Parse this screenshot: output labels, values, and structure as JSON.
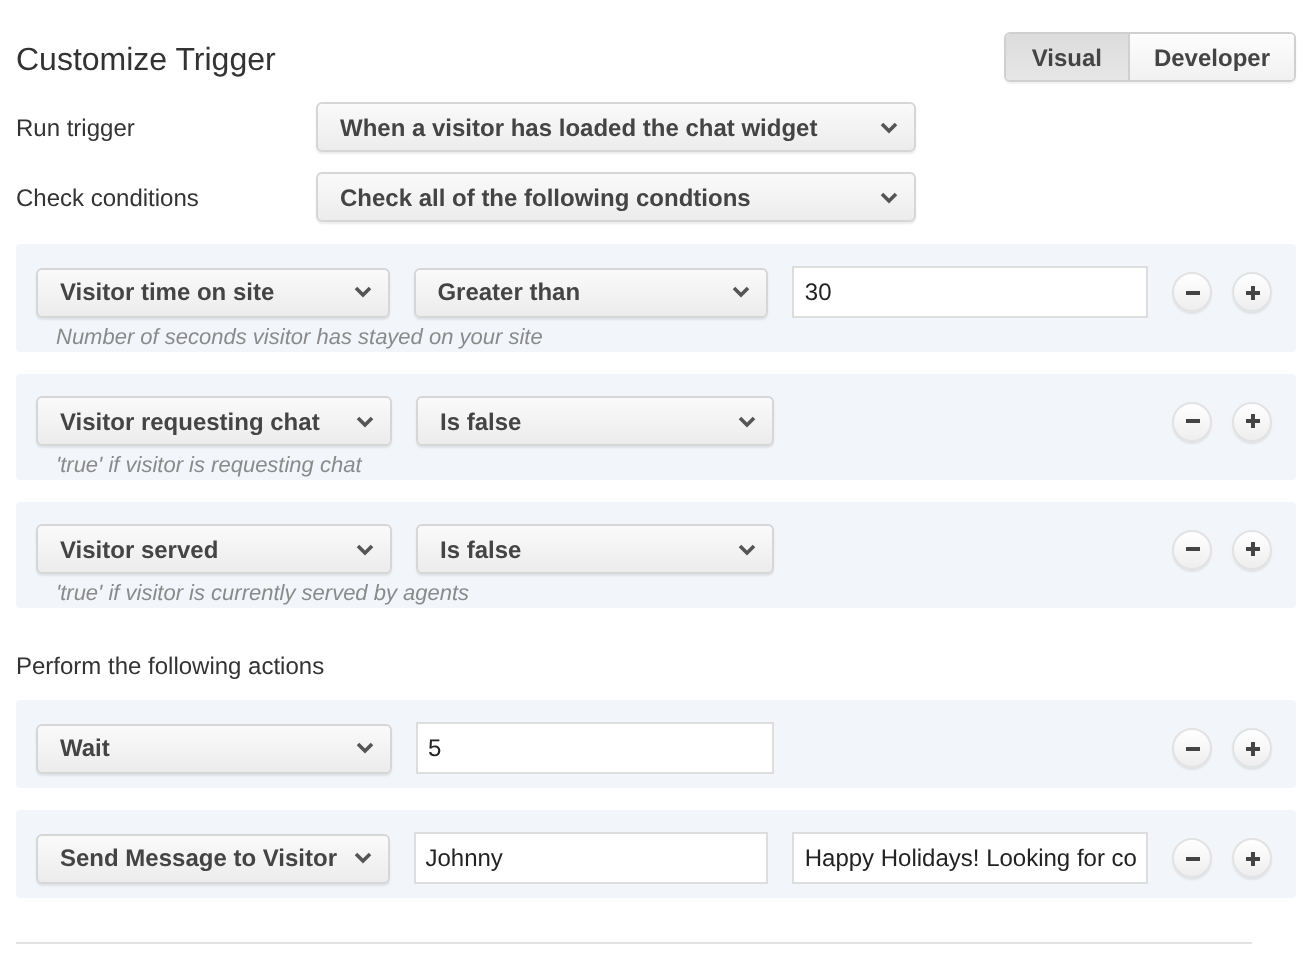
{
  "title": "Customize Trigger",
  "mode_tabs": [
    {
      "label": "Visual",
      "selected": true
    },
    {
      "label": "Developer",
      "selected": false
    }
  ],
  "settings": [
    {
      "label": "Run trigger",
      "value": "When a visitor has loaded the chat widget"
    },
    {
      "label": "Check conditions",
      "value": "Check all of the following condtions"
    }
  ],
  "conditions": [
    {
      "fields": [
        {
          "kind": "select",
          "value": "Visitor time on site"
        },
        {
          "kind": "select",
          "value": "Greater than"
        },
        {
          "kind": "input",
          "value": "30"
        }
      ],
      "hint": "Number of seconds visitor has stayed on your site"
    },
    {
      "fields": [
        {
          "kind": "select",
          "value": "Visitor requesting chat"
        },
        {
          "kind": "select",
          "value": "Is false"
        }
      ],
      "hint": "'true' if visitor is requesting chat"
    },
    {
      "fields": [
        {
          "kind": "select",
          "value": "Visitor served"
        },
        {
          "kind": "select",
          "value": "Is false"
        }
      ],
      "hint": "'true' if visitor is currently served by agents"
    }
  ],
  "actions_label": "Perform the following actions",
  "actions": [
    {
      "fields": [
        {
          "kind": "select",
          "value": "Wait"
        },
        {
          "kind": "input",
          "value": "5"
        }
      ]
    },
    {
      "fields": [
        {
          "kind": "select",
          "value": "Send Message to Visitor"
        },
        {
          "kind": "input",
          "value": "Johnny"
        },
        {
          "kind": "input",
          "value": "Happy Holidays! Looking for co"
        }
      ]
    }
  ]
}
